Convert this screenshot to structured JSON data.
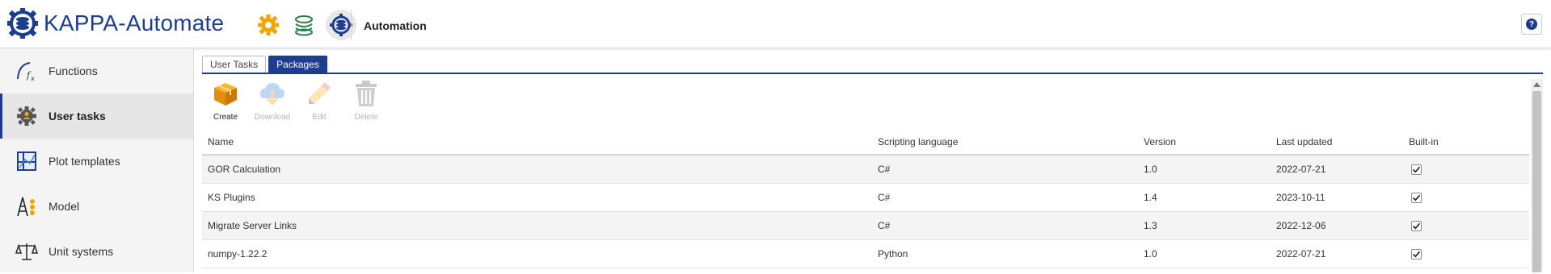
{
  "app": {
    "name": "KAPPA-Automate",
    "section_title": "Automation"
  },
  "header_icons": [
    {
      "icon": "gear-icon",
      "active": false
    },
    {
      "icon": "layers-icon",
      "active": false
    },
    {
      "icon": "automation-icon",
      "active": true
    }
  ],
  "help": {
    "label": "?"
  },
  "sidebar": {
    "items": [
      {
        "label": "Functions",
        "icon": "function-fx-icon",
        "active": false
      },
      {
        "label": "User tasks",
        "icon": "user-task-gear-icon",
        "active": true
      },
      {
        "label": "Plot templates",
        "icon": "plot-template-icon",
        "active": false
      },
      {
        "label": "Model",
        "icon": "model-icon",
        "active": false
      },
      {
        "label": "Unit systems",
        "icon": "scale-icon",
        "active": false
      }
    ]
  },
  "tabs": [
    {
      "label": "User Tasks",
      "active": false
    },
    {
      "label": "Packages",
      "active": true
    }
  ],
  "toolbar": {
    "create": "Create",
    "download": "Download",
    "edit": "Edit",
    "delete": "Delete"
  },
  "table": {
    "columns": [
      "Name",
      "Scripting language",
      "Version",
      "Last updated",
      "Built-in"
    ],
    "rows": [
      {
        "name": "GOR Calculation",
        "language": "C#",
        "version": "1.0",
        "updated": "2022-07-21",
        "builtin": true
      },
      {
        "name": "KS Plugins",
        "language": "C#",
        "version": "1.4",
        "updated": "2023-10-11",
        "builtin": true
      },
      {
        "name": "Migrate Server Links",
        "language": "C#",
        "version": "1.3",
        "updated": "2022-12-06",
        "builtin": true
      },
      {
        "name": "numpy-1.22.2",
        "language": "Python",
        "version": "1.0",
        "updated": "2022-07-21",
        "builtin": true
      }
    ]
  },
  "colors": {
    "brand": "#1e3d8f",
    "accent_gear": "#f0a500",
    "accent_layers": "#2e7d4f"
  }
}
